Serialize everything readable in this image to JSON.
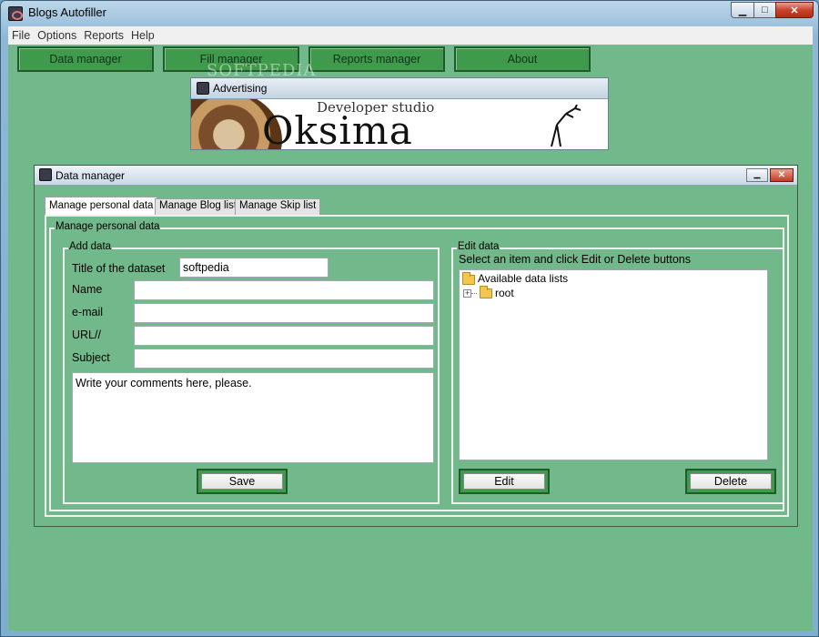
{
  "window": {
    "title": "Blogs Autofiller",
    "min_glyph": "▁",
    "max_glyph": "□",
    "close_glyph": "✕"
  },
  "menu": {
    "items": [
      "File",
      "Options",
      "Reports",
      "Help"
    ]
  },
  "nav": {
    "buttons": [
      "Data manager",
      "Fill manager",
      "Reports manager",
      "About"
    ]
  },
  "watermark": "SOFTPEDIA",
  "advertising": {
    "title": "Advertising",
    "subtitle": "Developer studio",
    "brand": "Oksima"
  },
  "data_manager": {
    "title": "Data manager",
    "min_glyph": "▁",
    "close_glyph": "✕",
    "tabs": [
      "Manage personal data",
      "Manage Blog list",
      "Manage Skip list"
    ],
    "group_title": "Manage personal data",
    "add_data": {
      "title": "Add data",
      "fields": [
        {
          "label": "Title of the dataset",
          "value": "softpedia"
        },
        {
          "label": "Name",
          "value": ""
        },
        {
          "label": "e-mail",
          "value": ""
        },
        {
          "label": "URL//",
          "value": ""
        },
        {
          "label": "Subject",
          "value": ""
        }
      ],
      "comments": "Write your comments here, please.",
      "save_label": "Save"
    },
    "edit_data": {
      "title": "Edit data",
      "hint": "Select an item and click Edit or Delete buttons",
      "tree_root": "Available data lists",
      "tree_child": "root",
      "edit_label": "Edit",
      "delete_label": "Delete"
    }
  }
}
